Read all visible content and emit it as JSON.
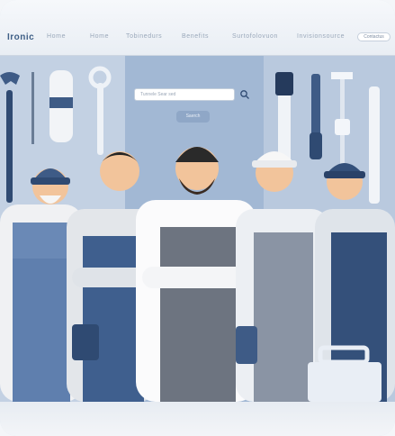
{
  "nav": {
    "logo": "Ironic",
    "links": [
      "Home",
      "Home",
      "Tobinedurs",
      "Benefits",
      "Surtofolovuon",
      "Invisionsource"
    ],
    "cta": "Contactus"
  },
  "hero": {
    "search_placeholder": "Tunnele Sear sed",
    "search_button": "Saerch"
  },
  "colors": {
    "navy": "#34507a",
    "overall_blue": "#5877a4",
    "gray_overall": "#6d7480",
    "skin": "#f2c49b",
    "hero_bg": "#a9bdd6"
  },
  "icons": [
    "search-icon",
    "wrench-icon",
    "screwdriver-icon",
    "toolbox-icon"
  ]
}
